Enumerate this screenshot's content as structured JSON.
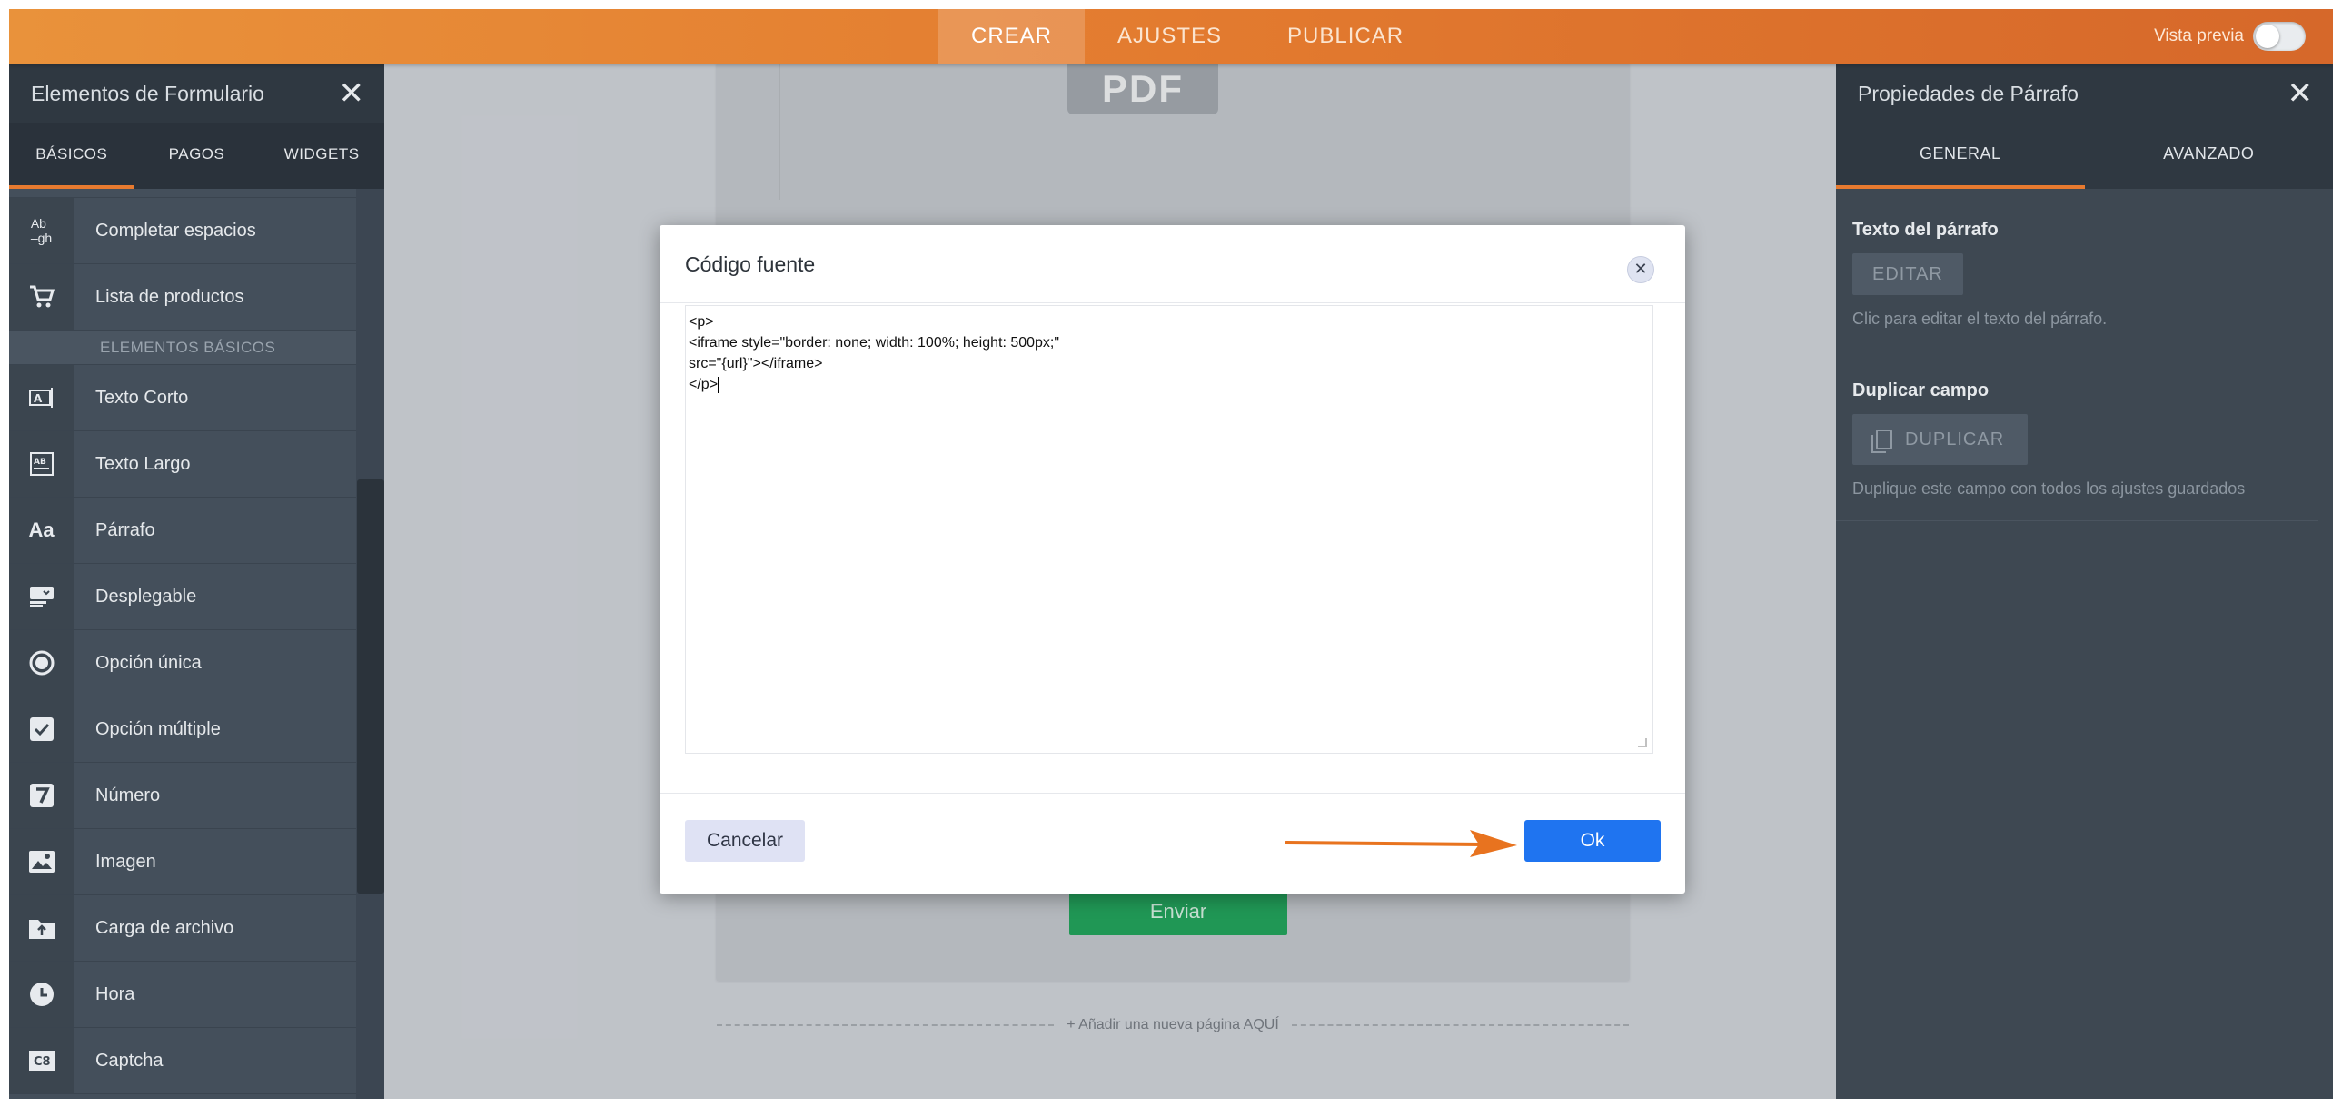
{
  "topbar": {
    "nav": [
      {
        "label": "CREAR",
        "active": true
      },
      {
        "label": "AJUSTES",
        "active": false
      },
      {
        "label": "PUBLICAR",
        "active": false
      }
    ],
    "preview_label": "Vista previa"
  },
  "left_panel": {
    "title": "Elementos de Formulario",
    "tabs": [
      {
        "label": "BÁSICOS",
        "active": true
      },
      {
        "label": "PAGOS",
        "active": false
      },
      {
        "label": "WIDGETS",
        "active": false
      }
    ],
    "items_top": [
      {
        "label": "Completar espacios",
        "icon": "fill-blanks-icon",
        "glyph": "Ab"
      },
      {
        "label": "Lista de productos",
        "icon": "cart-icon",
        "glyph": "🛒"
      }
    ],
    "section_label": "ELEMENTOS BÁSICOS",
    "items": [
      {
        "label": "Texto Corto",
        "icon": "short-text-icon",
        "glyph": "A"
      },
      {
        "label": "Texto Largo",
        "icon": "long-text-icon",
        "glyph": "AB"
      },
      {
        "label": "Párrafo",
        "icon": "paragraph-icon",
        "glyph": "Aa"
      },
      {
        "label": "Desplegable",
        "icon": "dropdown-icon",
        "glyph": "▤"
      },
      {
        "label": "Opción única",
        "icon": "radio-icon",
        "glyph": "◉"
      },
      {
        "label": "Opción múltiple",
        "icon": "checkbox-icon",
        "glyph": "☑"
      },
      {
        "label": "Número",
        "icon": "number-icon",
        "glyph": "7"
      },
      {
        "label": "Imagen",
        "icon": "image-icon",
        "glyph": "▨"
      },
      {
        "label": "Carga de archivo",
        "icon": "upload-icon",
        "glyph": "⇪"
      },
      {
        "label": "Hora",
        "icon": "clock-icon",
        "glyph": "◷"
      },
      {
        "label": "Captcha",
        "icon": "captcha-icon",
        "glyph": "C8"
      }
    ]
  },
  "canvas": {
    "pdf_label": "PDF",
    "submit_label": "Enviar",
    "add_page_label": "+ Añadir una nueva página AQUÍ"
  },
  "right_panel": {
    "title": "Propiedades de Párrafo",
    "tabs": [
      {
        "label": "GENERAL",
        "active": true
      },
      {
        "label": "AVANZADO",
        "active": false
      }
    ],
    "text_section": {
      "title": "Texto del párrafo",
      "button": "EDITAR",
      "desc": "Clic para editar el texto del párrafo."
    },
    "dup_section": {
      "title": "Duplicar campo",
      "button": "DUPLICAR",
      "desc": "Duplique este campo con todos los ajustes guardados"
    }
  },
  "modal": {
    "title": "Código fuente",
    "code_lines": [
      "<p>",
      "<iframe style=\"border: none; width: 100%; height: 500px;\"",
      "src=\"{url}\"></iframe>",
      "</p>"
    ],
    "cancel_label": "Cancelar",
    "ok_label": "Ok",
    "accent": "#1f74f0",
    "arrow_color": "#e8731f"
  }
}
